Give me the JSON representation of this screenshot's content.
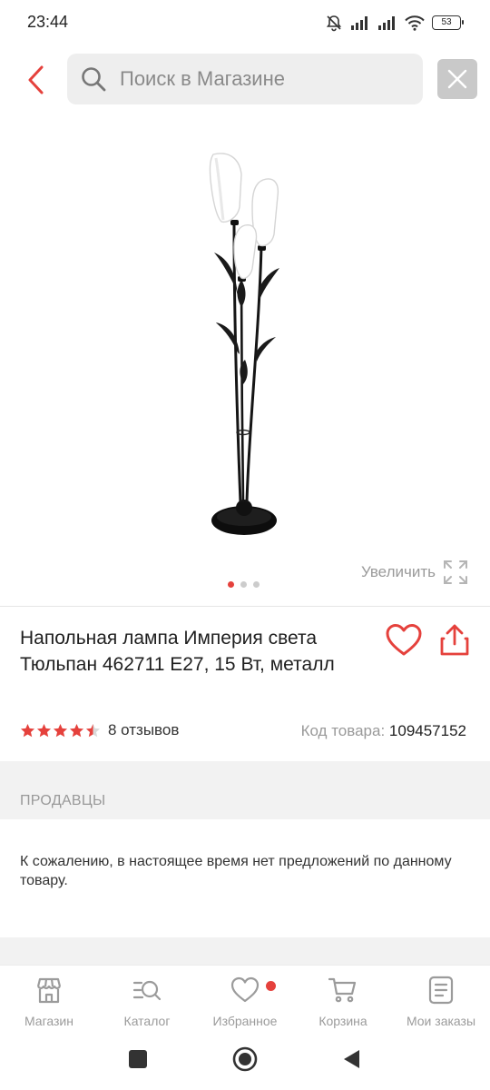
{
  "status": {
    "time": "23:44",
    "battery": "53"
  },
  "search": {
    "placeholder": "Поиск в Магазине",
    "value": ""
  },
  "gallery": {
    "zoom_label": "Увеличить",
    "slide_count": 3,
    "active_slide": 1
  },
  "product": {
    "title": "Напольная лампа Империя света Тюльпан 462711 E27, 15 Вт, металл",
    "rating_stars": 4.5,
    "reviews": "8 отзывов",
    "sku_label": "Код товара:",
    "sku_value": "109457152"
  },
  "sellers": {
    "title": "ПРОДАВЦЫ",
    "message": "К сожалению, в настоящее время нет предложений по данному товару."
  },
  "bottom_nav": {
    "items": [
      {
        "label": "Магазин",
        "icon": "store-icon"
      },
      {
        "label": "Каталог",
        "icon": "catalog-search-icon"
      },
      {
        "label": "Избранное",
        "icon": "heart-icon"
      },
      {
        "label": "Корзина",
        "icon": "cart-icon"
      },
      {
        "label": "Мои заказы",
        "icon": "orders-icon"
      }
    ]
  },
  "colors": {
    "accent": "#e5413c",
    "muted_text": "#9b9b9b",
    "section_bg": "#f2f2f2"
  }
}
